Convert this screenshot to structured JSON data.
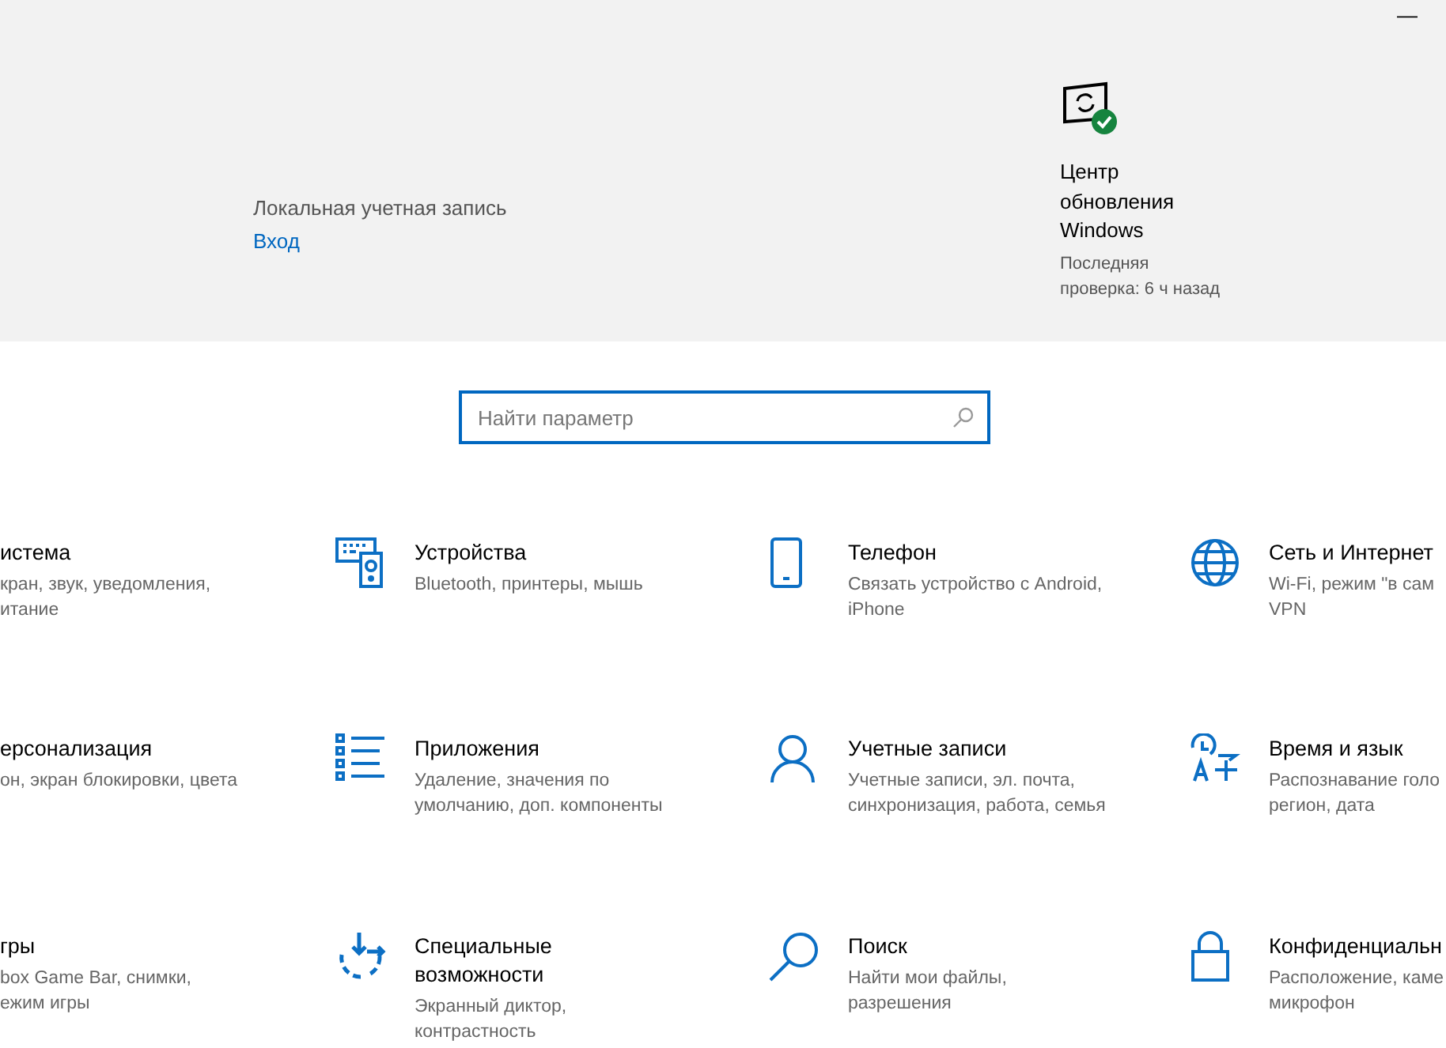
{
  "window": {
    "minimize": "—"
  },
  "account": {
    "label": "Локальная учетная запись",
    "link": "Вход"
  },
  "update": {
    "title": "Центр обновления Windows",
    "subtitle": "Последняя проверка: 6 ч назад"
  },
  "search": {
    "placeholder": "Найти параметр"
  },
  "categories": [
    {
      "title": [
        "истема"
      ],
      "description": [
        "кран, звук, уведомления,",
        "итание"
      ]
    },
    {
      "title": [
        "Устройства"
      ],
      "description": [
        "Bluetooth, принтеры, мышь"
      ]
    },
    {
      "title": [
        "Телефон"
      ],
      "description": [
        "Связать устройство с Android,",
        "iPhone"
      ]
    },
    {
      "title": [
        "Сеть и Интернет"
      ],
      "description": [
        "Wi-Fi, режим \"в сам",
        "VPN"
      ]
    },
    {
      "title": [
        "ерсонализация"
      ],
      "description": [
        "он, экран блокировки, цвета"
      ]
    },
    {
      "title": [
        "Приложения"
      ],
      "description": [
        "Удаление, значения по",
        "умолчанию, доп. компоненты"
      ]
    },
    {
      "title": [
        "Учетные записи"
      ],
      "description": [
        "Учетные записи, эл. почта,",
        "синхронизация, работа, семья"
      ]
    },
    {
      "title": [
        "Время и язык"
      ],
      "description": [
        "Распознавание голо",
        "регион, дата"
      ]
    },
    {
      "title": [
        "гры"
      ],
      "description": [
        "box Game Bar, снимки,",
        "ежим игры"
      ]
    },
    {
      "title": [
        "Специальные",
        "возможности"
      ],
      "description": [
        "Экранный диктор,",
        "контрастность"
      ]
    },
    {
      "title": [
        "Поиск"
      ],
      "description": [
        "Найти мои файлы,",
        "разрешения"
      ]
    },
    {
      "title": [
        "Конфиденциальн"
      ],
      "description": [
        "Расположение, каме",
        "микрофон"
      ]
    }
  ]
}
